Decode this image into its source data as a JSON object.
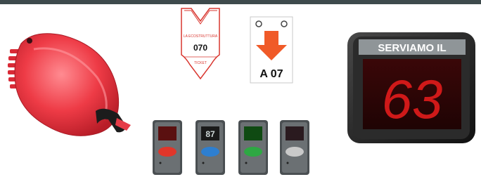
{
  "colors": {
    "top_bar": "#3e4a4c",
    "dispenser_red": "#ee3b46",
    "arrow_orange": "#f05a28",
    "display_red": "#e21c1c",
    "ticket_red_text": "#d9362f"
  },
  "ticket_tear": {
    "brand_text": "LA ECOSTRUTTURA",
    "number": "070",
    "footer_text": "TICKET"
  },
  "ticket_arrow": {
    "code": "A 07"
  },
  "wall_display": {
    "header": "SERVIAMO IL",
    "number": "63"
  },
  "remotes": [
    {
      "name": "red",
      "screen_color": "#5a1010",
      "button_color": "#e0362a",
      "digits": ""
    },
    {
      "name": "blue",
      "screen_color": "#1a1a1a",
      "button_color": "#2e7fd0",
      "digits": "87"
    },
    {
      "name": "green",
      "screen_color": "#0f4a12",
      "button_color": "#2ea843",
      "digits": ""
    },
    {
      "name": "grey",
      "screen_color": "#2a1a1f",
      "button_color": "#c9c9c9",
      "digits": ""
    }
  ]
}
